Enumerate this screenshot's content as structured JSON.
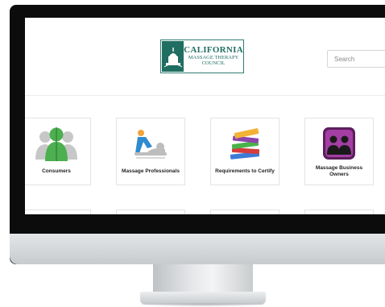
{
  "site": {
    "logo": {
      "line1": "CALIFORNIA",
      "line2": "MASSAGE THERAPY",
      "line3": "COUNCIL",
      "icon": "capitol-building-icon"
    },
    "search": {
      "placeholder": "Search"
    }
  },
  "categories": [
    {
      "label": "Consumers",
      "icon": "people-silhouette-icon"
    },
    {
      "label": "Massage Professionals",
      "icon": "massage-therapist-icon"
    },
    {
      "label": "Requirements to Certify",
      "icon": "book-stack-icon"
    },
    {
      "label": "Massage Business Owners",
      "icon": "business-people-icon"
    }
  ],
  "colors": {
    "brand": "#1f6e61",
    "consumers_green": "#4caf50",
    "professional_blue": "#2f8ad0",
    "business_purple": "#8e2a8e",
    "bezel": "#0c0c0d"
  }
}
